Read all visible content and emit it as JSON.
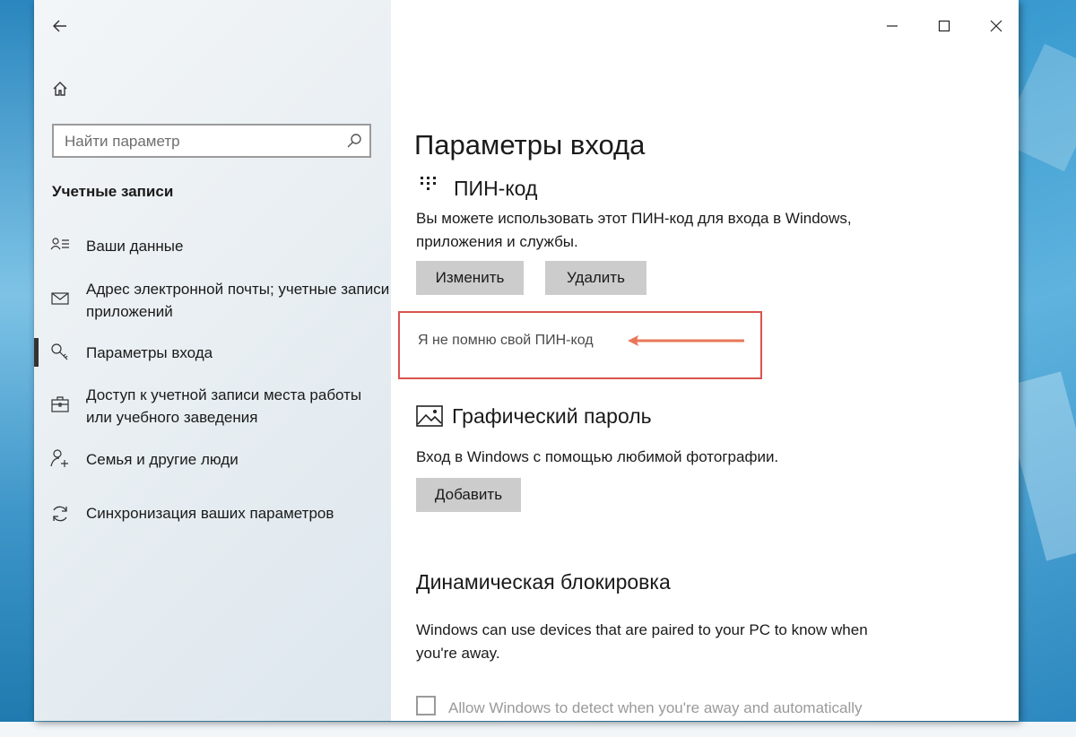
{
  "sidebar": {
    "search_placeholder": "Найти параметр",
    "section_title": "Учетные записи",
    "items": [
      {
        "label": "Ваши данные",
        "icon": "person-list-icon"
      },
      {
        "label": "Адрес электронной почты; учетные записи приложений",
        "icon": "mail-icon"
      },
      {
        "label": "Параметры входа",
        "icon": "key-icon",
        "active": true
      },
      {
        "label": "Доступ к учетной записи места работы или учебного заведения",
        "icon": "briefcase-icon"
      },
      {
        "label": "Семья и другие люди",
        "icon": "person-add-icon"
      },
      {
        "label": "Синхронизация ваших параметров",
        "icon": "sync-icon"
      }
    ]
  },
  "main": {
    "title": "Параметры входа",
    "pin": {
      "heading": "ПИН-код",
      "description_line1": "Вы можете использовать этот ПИН-код для входа в Windows,",
      "description_line2": "приложения и службы.",
      "change_label": "Изменить",
      "remove_label": "Удалить",
      "forgot_link": "Я не помню свой ПИН-код"
    },
    "picture_password": {
      "heading": "Графический пароль",
      "description": "Вход в Windows с помощью любимой фотографии.",
      "add_label": "Добавить"
    },
    "dynamic_lock": {
      "heading": "Динамическая блокировка",
      "description_line1": "Windows can use devices that are paired to your PC to know when",
      "description_line2": "you're away.",
      "checkbox_label": "Allow Windows to detect when you're away and automatically"
    }
  },
  "colors": {
    "highlight_border": "#d9534f",
    "arrow": "#e8775a",
    "button_bg": "#cccccc",
    "desktop_bg": "#3a9bd0"
  }
}
